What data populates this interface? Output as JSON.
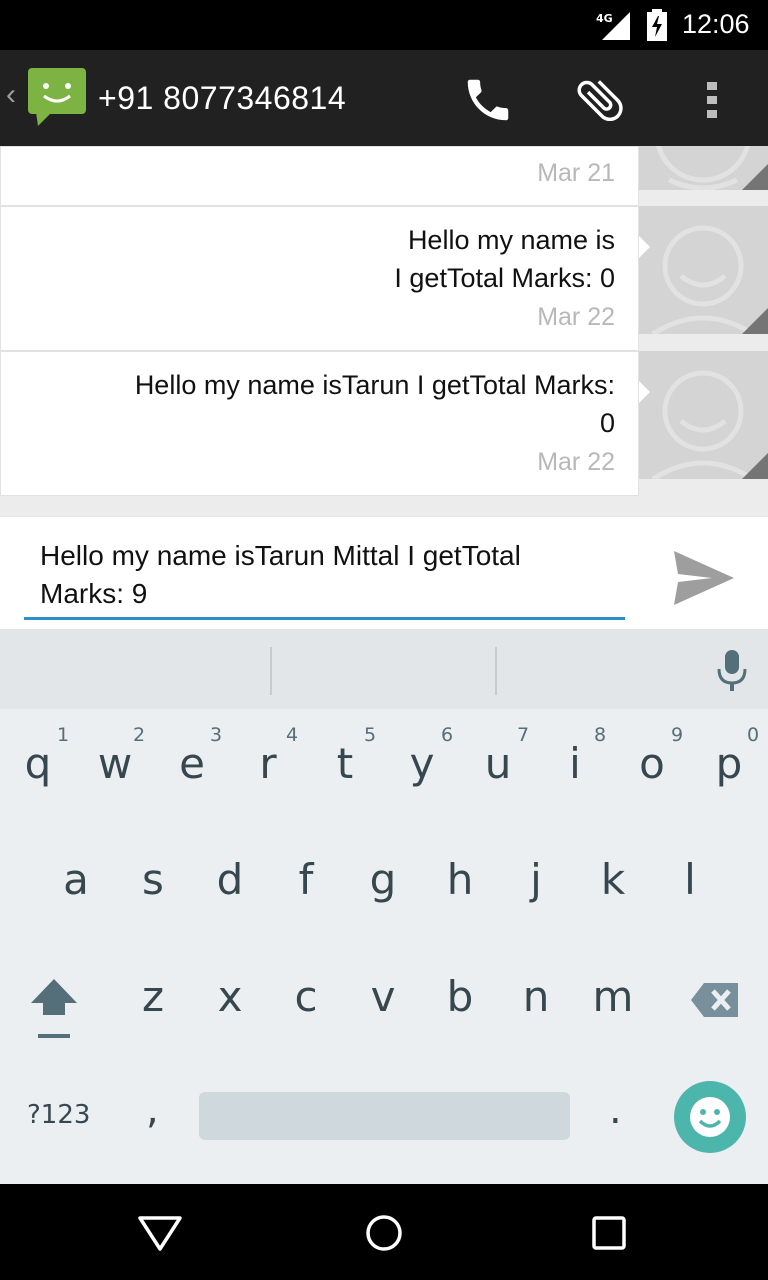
{
  "status_bar": {
    "network": "4G",
    "time": "12:06"
  },
  "action_bar": {
    "back": "‹",
    "title": "+91 8077346814"
  },
  "messages": [
    {
      "body_lines": [],
      "date": "Mar 21"
    },
    {
      "body_lines": [
        "Hello my name is",
        "I getTotal Marks: 0"
      ],
      "date": "Mar 22"
    },
    {
      "body_lines": [
        "Hello my name isTarun I getTotal Marks:",
        "0"
      ],
      "date": "Mar 22"
    }
  ],
  "compose": {
    "lines": [
      "Hello my name isTarun Mittal I getTotal",
      "Marks: 9"
    ]
  },
  "keyboard": {
    "row1": [
      "q",
      "w",
      "e",
      "r",
      "t",
      "y",
      "u",
      "i",
      "o",
      "p"
    ],
    "row1_hints": [
      "1",
      "2",
      "3",
      "4",
      "5",
      "6",
      "7",
      "8",
      "9",
      "0"
    ],
    "row2": [
      "a",
      "s",
      "d",
      "f",
      "g",
      "h",
      "j",
      "k",
      "l"
    ],
    "row3": [
      "z",
      "x",
      "c",
      "v",
      "b",
      "n",
      "m"
    ],
    "symbols_label": "?123",
    "comma": ",",
    "period": "."
  },
  "colors": {
    "accent": "#2b8fc8",
    "emoji_button": "#4db6ac",
    "app_icon": "#7cb342"
  }
}
